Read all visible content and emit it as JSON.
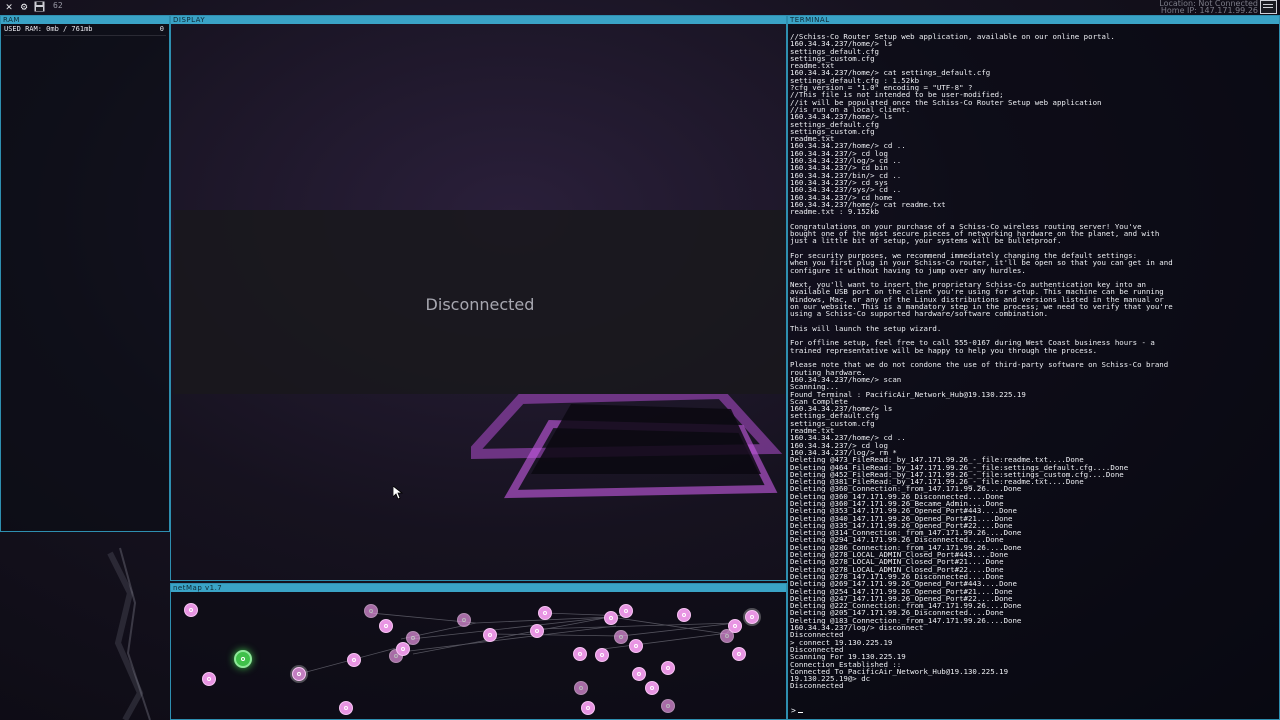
{
  "topbar": {
    "icons": [
      "close-icon",
      "gear-icon",
      "save-icon"
    ],
    "count": "62",
    "location_line": "Location: Not Connected",
    "home_ip_line": "Home IP: 147.171.99.26"
  },
  "ram": {
    "title": "RAM",
    "used_label": "USED RAM: 0mb / 761mb",
    "used_value": "0"
  },
  "display": {
    "title": "DISPLAY",
    "status": "Disconnected"
  },
  "netmap": {
    "title": "netMap v1.7"
  },
  "terminal": {
    "title": "TERMINAL",
    "lines": [
      "//Schiss-Co Router Setup web application, available on our online portal.",
      "160.34.34.237/home/> ls",
      "settings_default.cfg",
      "settings_custom.cfg",
      "readme.txt",
      "160.34.34.237/home/> cat settings_default.cfg",
      "settings_default.cfg : 1.52kb",
      "?cfg version = \"1.0\" encoding = \"UTF-8\" ?",
      "//This file is not intended to be user-modified;",
      "//it will be populated once the Schiss-Co Router Setup web application",
      "//is run on a local client.",
      "160.34.34.237/home/> ls",
      "settings_default.cfg",
      "settings_custom.cfg",
      "readme.txt",
      "160.34.34.237/home/> cd ..",
      "160.34.34.237/> cd log",
      "160.34.34.237/log/> cd ..",
      "160.34.34.237/> cd bin",
      "160.34.34.237/bin/> cd ..",
      "160.34.34.237/> cd sys",
      "160.34.34.237/sys/> cd ..",
      "160.34.34.237/> cd home",
      "160.34.34.237/home/> cat readme.txt",
      "readme.txt : 9.152kb",
      "",
      "Congratulations on your purchase of a Schiss-Co wireless routing server! You've",
      "bought one of the most secure pieces of networking hardware on the planet, and with",
      "just a little bit of setup, your systems will be bulletproof.",
      "",
      "For security purposes, we recommend immediately changing the default settings:",
      "when you first plug in your Schiss-Co router, it'll be open so that you can get in and",
      "configure it without having to jump over any hurdles.",
      "",
      "Next, you'll want to insert the proprietary Schiss-Co authentication key into an",
      "available USB port on the client you're using for setup. This machine can be running",
      "Windows, Mac, or any of the Linux distributions and versions listed in the manual or",
      "on our website. This is a mandatory step in the process; we need to verify that you're",
      "using a Schiss-Co supported hardware/software combination.",
      "",
      "This will launch the setup wizard.",
      "",
      "For offline setup, feel free to call 555-0167 during West Coast business hours - a",
      "trained representative will be happy to help you through the process.",
      "",
      "Please note that we do not condone the use of third-party software on Schiss-Co brand",
      "routing hardware.",
      "160.34.34.237/home/> scan",
      "Scanning...",
      "Found Terminal : PacificAir_Network_Hub@19.130.225.19",
      "Scan Complete",
      "160.34.34.237/home/> ls",
      "settings_default.cfg",
      "settings_custom.cfg",
      "readme.txt",
      "160.34.34.237/home/> cd ..",
      "160.34.34.237/> cd log",
      "160.34.34.237/log/> rm *",
      "Deleting @473_FileRead:_by_147.171.99.26_-_file:readme.txt....Done",
      "Deleting @464_FileRead:_by_147.171.99.26_-_file:settings_default.cfg....Done",
      "Deleting @452_FileRead:_by_147.171.99.26_-_file:settings_custom.cfg....Done",
      "Deleting @381_FileRead:_by_147.171.99.26_-_file:readme.txt....Done",
      "Deleting @360_Connection:_from_147.171.99.26....Done",
      "Deleting @360_147.171.99.26_Disconnected....Done",
      "Deleting @360_147.171.99.26_Became_Admin....Done",
      "Deleting @353_147.171.99.26_Opened_Port#443....Done",
      "Deleting @340_147.171.99.26_Opened_Port#21....Done",
      "Deleting @335_147.171.99.26_Opened_Port#22....Done",
      "Deleting @314_Connection:_from_147.171.99.26....Done",
      "Deleting @294_147.171.99.26_Disconnected....Done",
      "Deleting @286_Connection:_from_147.171.99.26....Done",
      "Deleting @278_LOCAL_ADMIN_Closed_Port#443....Done",
      "Deleting @278_LOCAL_ADMIN_Closed_Port#21....Done",
      "Deleting @278_LOCAL_ADMIN_Closed_Port#22....Done",
      "Deleting @278_147.171.99.26_Disconnected....Done",
      "Deleting @269_147.171.99.26_Opened_Port#443....Done",
      "Deleting @254_147.171.99.26_Opened_Port#21....Done",
      "Deleting @247_147.171.99.26_Opened_Port#22....Done",
      "Deleting @222_Connection:_from_147.171.99.26....Done",
      "Deleting @205_147.171.99.26_Disconnected....Done",
      "Deleting @183_Connection:_from_147.171.99.26....Done",
      "160.34.34.237/log/> disconnect",
      "Disconnected",
      "> connect 19.130.225.19",
      "Disconnected",
      "Scanning For 19.130.225.19",
      "Connection Established ::",
      "Connected To PacificAir_Network_Hub@19.130.225.19",
      "19.130.225.19@> dc",
      "Disconnected"
    ],
    "prompt": ">"
  }
}
